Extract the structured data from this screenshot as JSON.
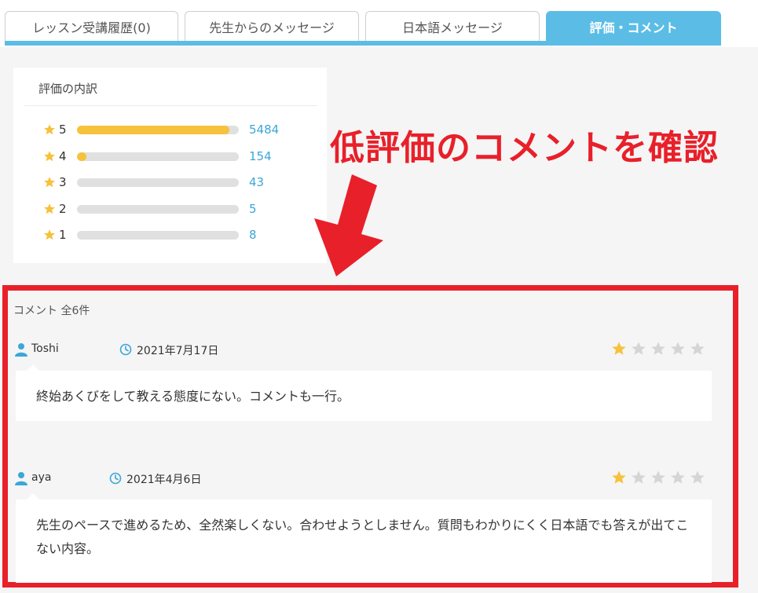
{
  "tabs": [
    {
      "label": "レッスン受講履歴(0)",
      "active": false
    },
    {
      "label": "先生からのメッセージ",
      "active": false
    },
    {
      "label": "日本語メッセージ",
      "active": false
    },
    {
      "label": "評価・コメント",
      "active": true
    }
  ],
  "breakdown": {
    "title": "評価の内訳",
    "rows": [
      {
        "stars": "5",
        "count": "5484",
        "fraction": 0.94
      },
      {
        "stars": "4",
        "count": "154",
        "fraction": 0.06
      },
      {
        "stars": "3",
        "count": "43",
        "fraction": 0.0
      },
      {
        "stars": "2",
        "count": "5",
        "fraction": 0.0
      },
      {
        "stars": "1",
        "count": "8",
        "fraction": 0.0
      }
    ]
  },
  "annotation": {
    "text": "低評価のコメントを確認",
    "color": "#e8202a"
  },
  "comments": {
    "count_label": "コメント 全6件",
    "items": [
      {
        "user": "Toshi",
        "date": "2021年7月17日",
        "rating": 1,
        "text": "終始あくびをして教える態度にない。コメントも一行。"
      },
      {
        "user": "aya",
        "date": "2021年4月6日",
        "rating": 1,
        "text": "先生のペースで進めるため、全然楽しくない。合わせようとしません。質問もわかりにくく日本語でも答えが出てこない内容。"
      }
    ]
  },
  "colors": {
    "accent": "#5bbde6",
    "star_filled": "#f6c23c",
    "star_empty": "#d5d5d5",
    "count_link": "#3aa7d9"
  }
}
